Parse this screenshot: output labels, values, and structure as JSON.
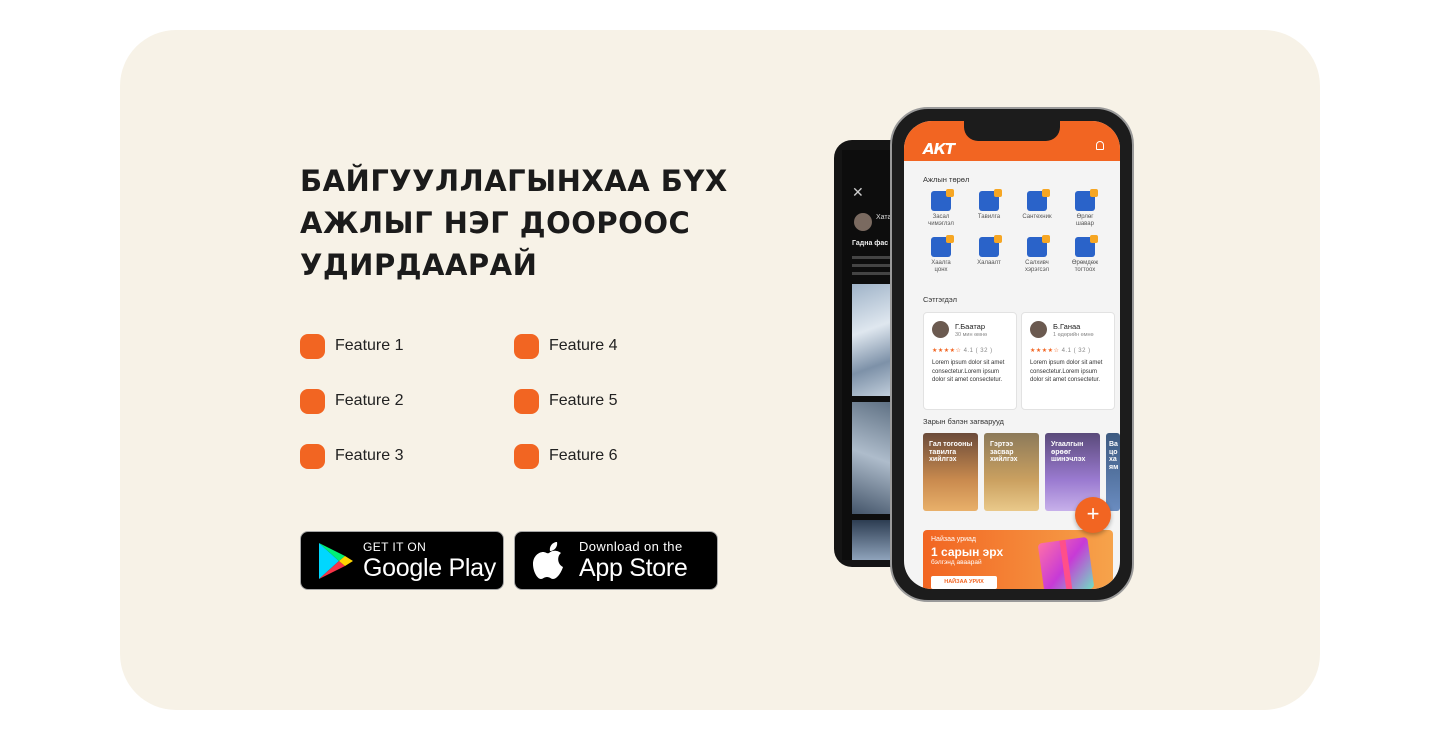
{
  "headline": [
    "БАЙГУУЛЛАГЫНХАА БҮХ",
    "АЖЛЫГ НЭГ ДООРООС",
    "УДИРДААРАЙ"
  ],
  "features": [
    "Feature 1",
    "Feature 2",
    "Feature 3",
    "Feature 4",
    "Feature 5",
    "Feature 6"
  ],
  "stores": {
    "google": {
      "small": "GET IT ON",
      "big": "Google Play"
    },
    "apple": {
      "small": "Download on the",
      "big": "App Store"
    }
  },
  "colors": {
    "accent": "#f26522",
    "card_bg": "#f7f2e7"
  },
  "app": {
    "logo": "АКТ",
    "section_jobs": "Ажлын төрөл",
    "categories": [
      [
        "Засал",
        "чимэглэл"
      ],
      [
        "Тавилга",
        ""
      ],
      [
        "Сантехник",
        ""
      ],
      [
        "Өрлөг",
        "шавар"
      ],
      [
        "Хаалга",
        "цонх"
      ],
      [
        "Халаалт",
        ""
      ],
      [
        "Салхивч",
        "хэрэгсэл"
      ],
      [
        "Өрөмдөж",
        "тогтоох"
      ]
    ],
    "section_reviews": "Сэтгэгдэл",
    "reviews": [
      {
        "name": "Г.Баатар",
        "time": "30 мин өмнө",
        "stars": "★★★★☆",
        "rating": "4.1 ( 32 )",
        "text": "Lorem ipsum dolor sit amet consectetur.Lorem ipsum dolor sit amet consectetur."
      },
      {
        "name": "Б.Ганаа",
        "time": "1 өдөрийн өмнө",
        "stars": "★★★★☆",
        "rating": "4.1 ( 32 )",
        "text": "Lorem ipsum dolor sit amet consectetur.Lorem ipsum dolor sit amet consectetur."
      }
    ],
    "section_templates": "Зарын бэлэн загварууд",
    "templates": [
      "Гал тогооны тавилга хийлгэх",
      "Гэртээ засвар хийлгэх",
      "Угаалгын өрөөг шинэчлэх",
      "Ва цо ха ям"
    ],
    "fab": "+",
    "banner": {
      "line1": "Найзаа уриад",
      "line2": "1 сарын эрх",
      "line3": "бэлгэнд аваарай",
      "button": "НАЙЗАА УРИХ"
    }
  },
  "back_phone": {
    "close": "✕",
    "name": "Хатаг",
    "title": "Гадна фас"
  }
}
